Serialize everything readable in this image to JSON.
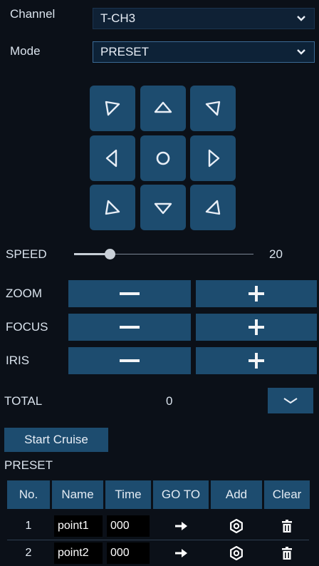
{
  "form": {
    "channel_label": "Channel",
    "channel_value": "T-CH3",
    "mode_label": "Mode",
    "mode_value": "PRESET"
  },
  "speed": {
    "label": "SPEED",
    "value": "20",
    "fraction": 0.2
  },
  "controls": [
    {
      "label": "ZOOM"
    },
    {
      "label": "FOCUS"
    },
    {
      "label": "IRIS"
    }
  ],
  "total": {
    "label": "TOTAL",
    "value": "0"
  },
  "cruise": {
    "button_label": "Start Cruise"
  },
  "preset": {
    "title": "PRESET",
    "columns": [
      "No.",
      "Name",
      "Time",
      "GO TO",
      "Add",
      "Clear"
    ],
    "rows": [
      {
        "no": "1",
        "name": "point1",
        "time": "000"
      },
      {
        "no": "2",
        "name": "point2",
        "time": "000"
      }
    ]
  },
  "colors": {
    "accent": "#1d4c6f",
    "background": "#0b1018"
  },
  "icons": {
    "ptz": [
      "arrow-up-left-icon",
      "arrow-up-icon",
      "arrow-up-right-icon",
      "arrow-left-icon",
      "center-circle-icon",
      "arrow-right-icon",
      "arrow-down-left-icon",
      "arrow-down-icon",
      "arrow-down-right-icon"
    ],
    "row_actions": [
      "goto-arrow-icon",
      "settings-gear-icon",
      "trash-icon"
    ]
  }
}
